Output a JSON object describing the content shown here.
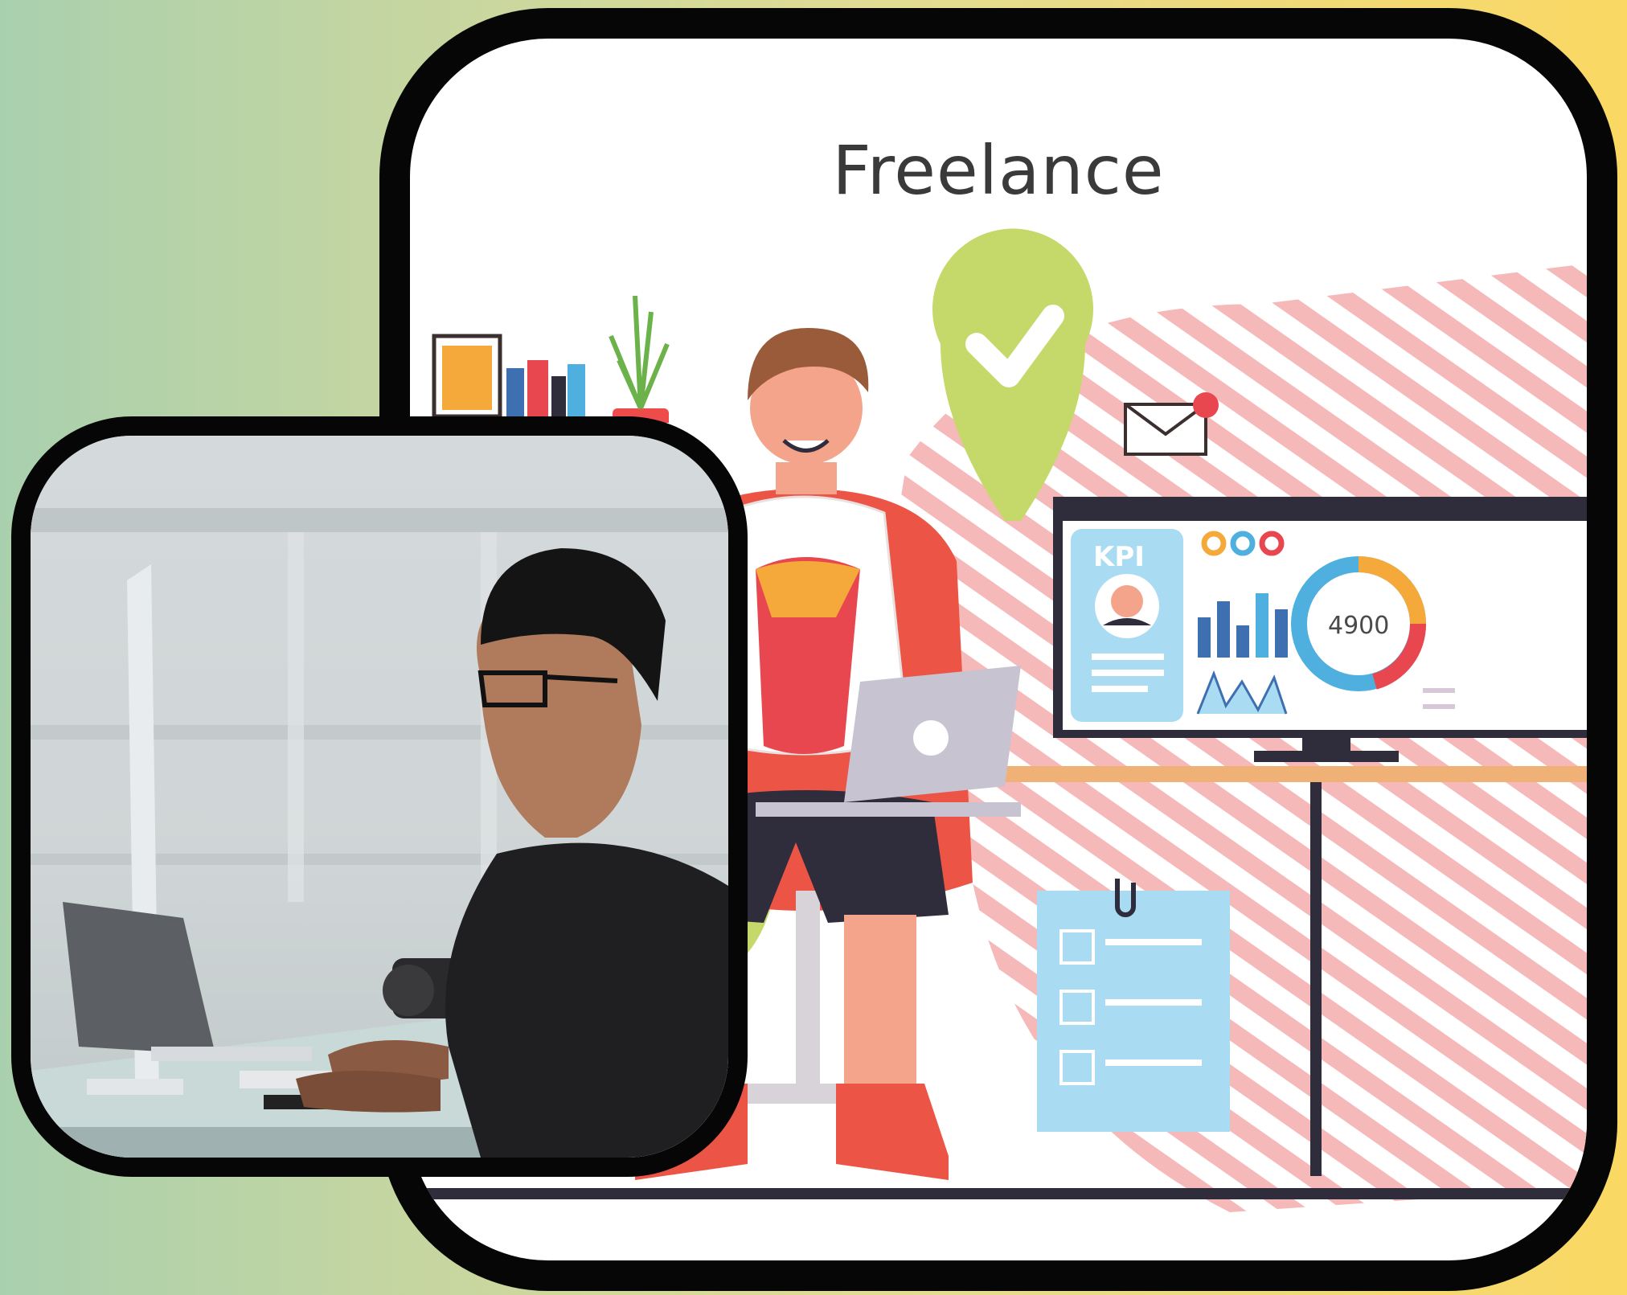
{
  "illustration": {
    "title": "Freelance",
    "kpi_label": "KPI",
    "kpi_value": "4900"
  },
  "colors": {
    "background_left": "#a9d0ae",
    "background_right": "#fbd863",
    "frame": "#060606",
    "chair_red": "#ec5545",
    "stripe_pink": "#f6b9b9",
    "check_green": "#c5d86a",
    "screen_blue": "#a9dcf2",
    "monitor_dark": "#2f2c3c"
  },
  "icons": [
    "check-bubble-icon",
    "envelope-icon",
    "paperclip-icon",
    "checkbox-icon"
  ]
}
